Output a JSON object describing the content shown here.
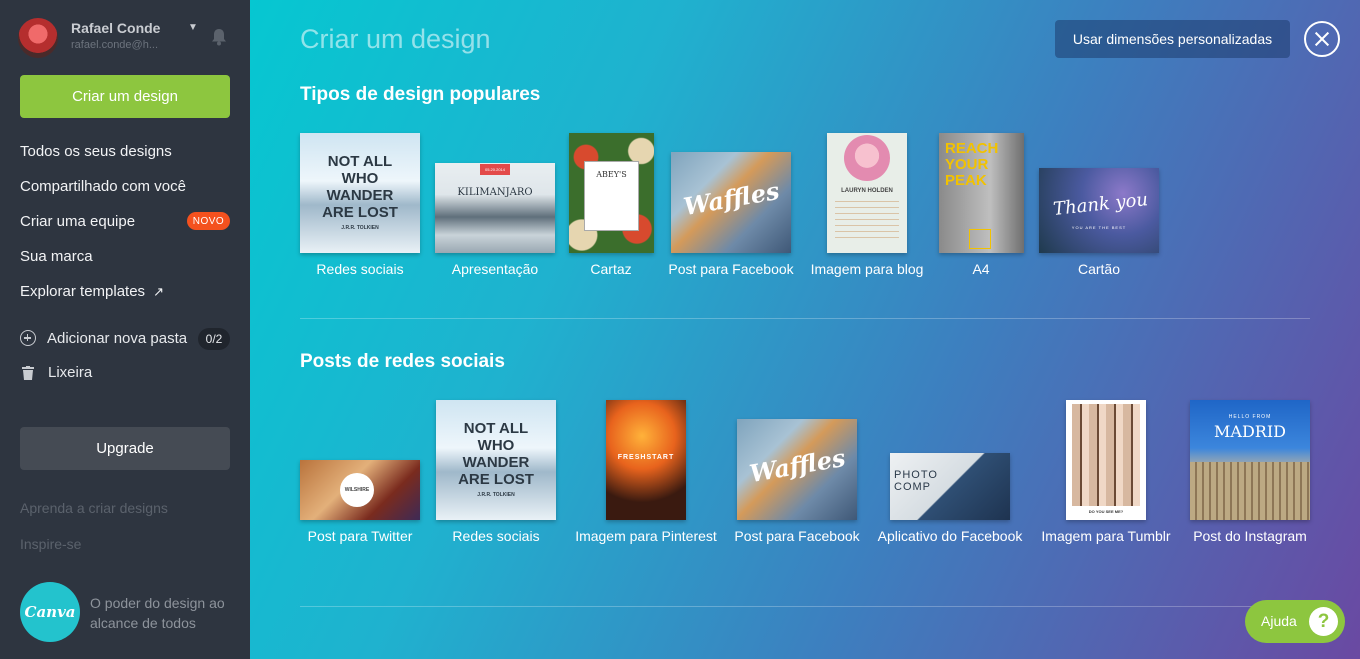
{
  "sidebar": {
    "user": {
      "name": "Rafael Conde",
      "email": "rafael.conde@h..."
    },
    "create_label": "Criar um design",
    "nav": [
      {
        "label": "Todos os seus designs"
      },
      {
        "label": "Compartilhado com você"
      },
      {
        "label": "Criar uma equipe",
        "badge": "NOVO"
      },
      {
        "label": "Sua marca"
      },
      {
        "label": "Explorar templates"
      }
    ],
    "folder": {
      "label": "Adicionar nova pasta",
      "count": "0/2"
    },
    "trash_label": "Lixeira",
    "upgrade_label": "Upgrade",
    "learn_label": "Aprenda a criar designs",
    "inspire_label": "Inspire-se",
    "logo_text": "Canva",
    "tagline": "O poder do design ao alcance de todos"
  },
  "main": {
    "title": "Criar um design",
    "custom_size_label": "Usar dimensões personalizadas",
    "popular": {
      "title": "Tipos de design populares",
      "items": [
        {
          "label": "Redes sociais",
          "thumb_text": "NOT ALL WHO WANDER ARE LOST",
          "thumb_sub": "J.R.R. TOLKIEN"
        },
        {
          "label": "Apresentação",
          "thumb_text": "KILIMANJARO",
          "thumb_date": "05.20.2014"
        },
        {
          "label": "Cartaz",
          "thumb_text": "ABEY'S"
        },
        {
          "label": "Post para Facebook",
          "thumb_text": "Waffles"
        },
        {
          "label": "Imagem para blog",
          "thumb_text": "LAURYN HOLDEN"
        },
        {
          "label": "A4",
          "thumb_text": "REACH YOUR PEAK"
        },
        {
          "label": "Cartão",
          "thumb_text": "Thank you",
          "thumb_sub": "YOU ARE THE BEST"
        }
      ]
    },
    "social": {
      "title": "Posts de redes sociais",
      "items": [
        {
          "label": "Post para Twitter",
          "thumb_text": "WILSHIRE"
        },
        {
          "label": "Redes sociais",
          "thumb_text": "NOT ALL WHO WANDER ARE LOST",
          "thumb_sub": "J.R.R. TOLKIEN"
        },
        {
          "label": "Imagem para Pinterest",
          "thumb_text": "FRESHSTART"
        },
        {
          "label": "Post para Facebook",
          "thumb_text": "Waffles"
        },
        {
          "label": "Aplicativo do Facebook",
          "thumb_text": "PHOTO COMP"
        },
        {
          "label": "Imagem para Tumblr",
          "thumb_text": "DO YOU SEE ME?"
        },
        {
          "label": "Post do Instagram",
          "thumb_text": "MADRID",
          "thumb_sub": "HELLO FROM"
        }
      ]
    },
    "help_label": "Ajuda"
  }
}
